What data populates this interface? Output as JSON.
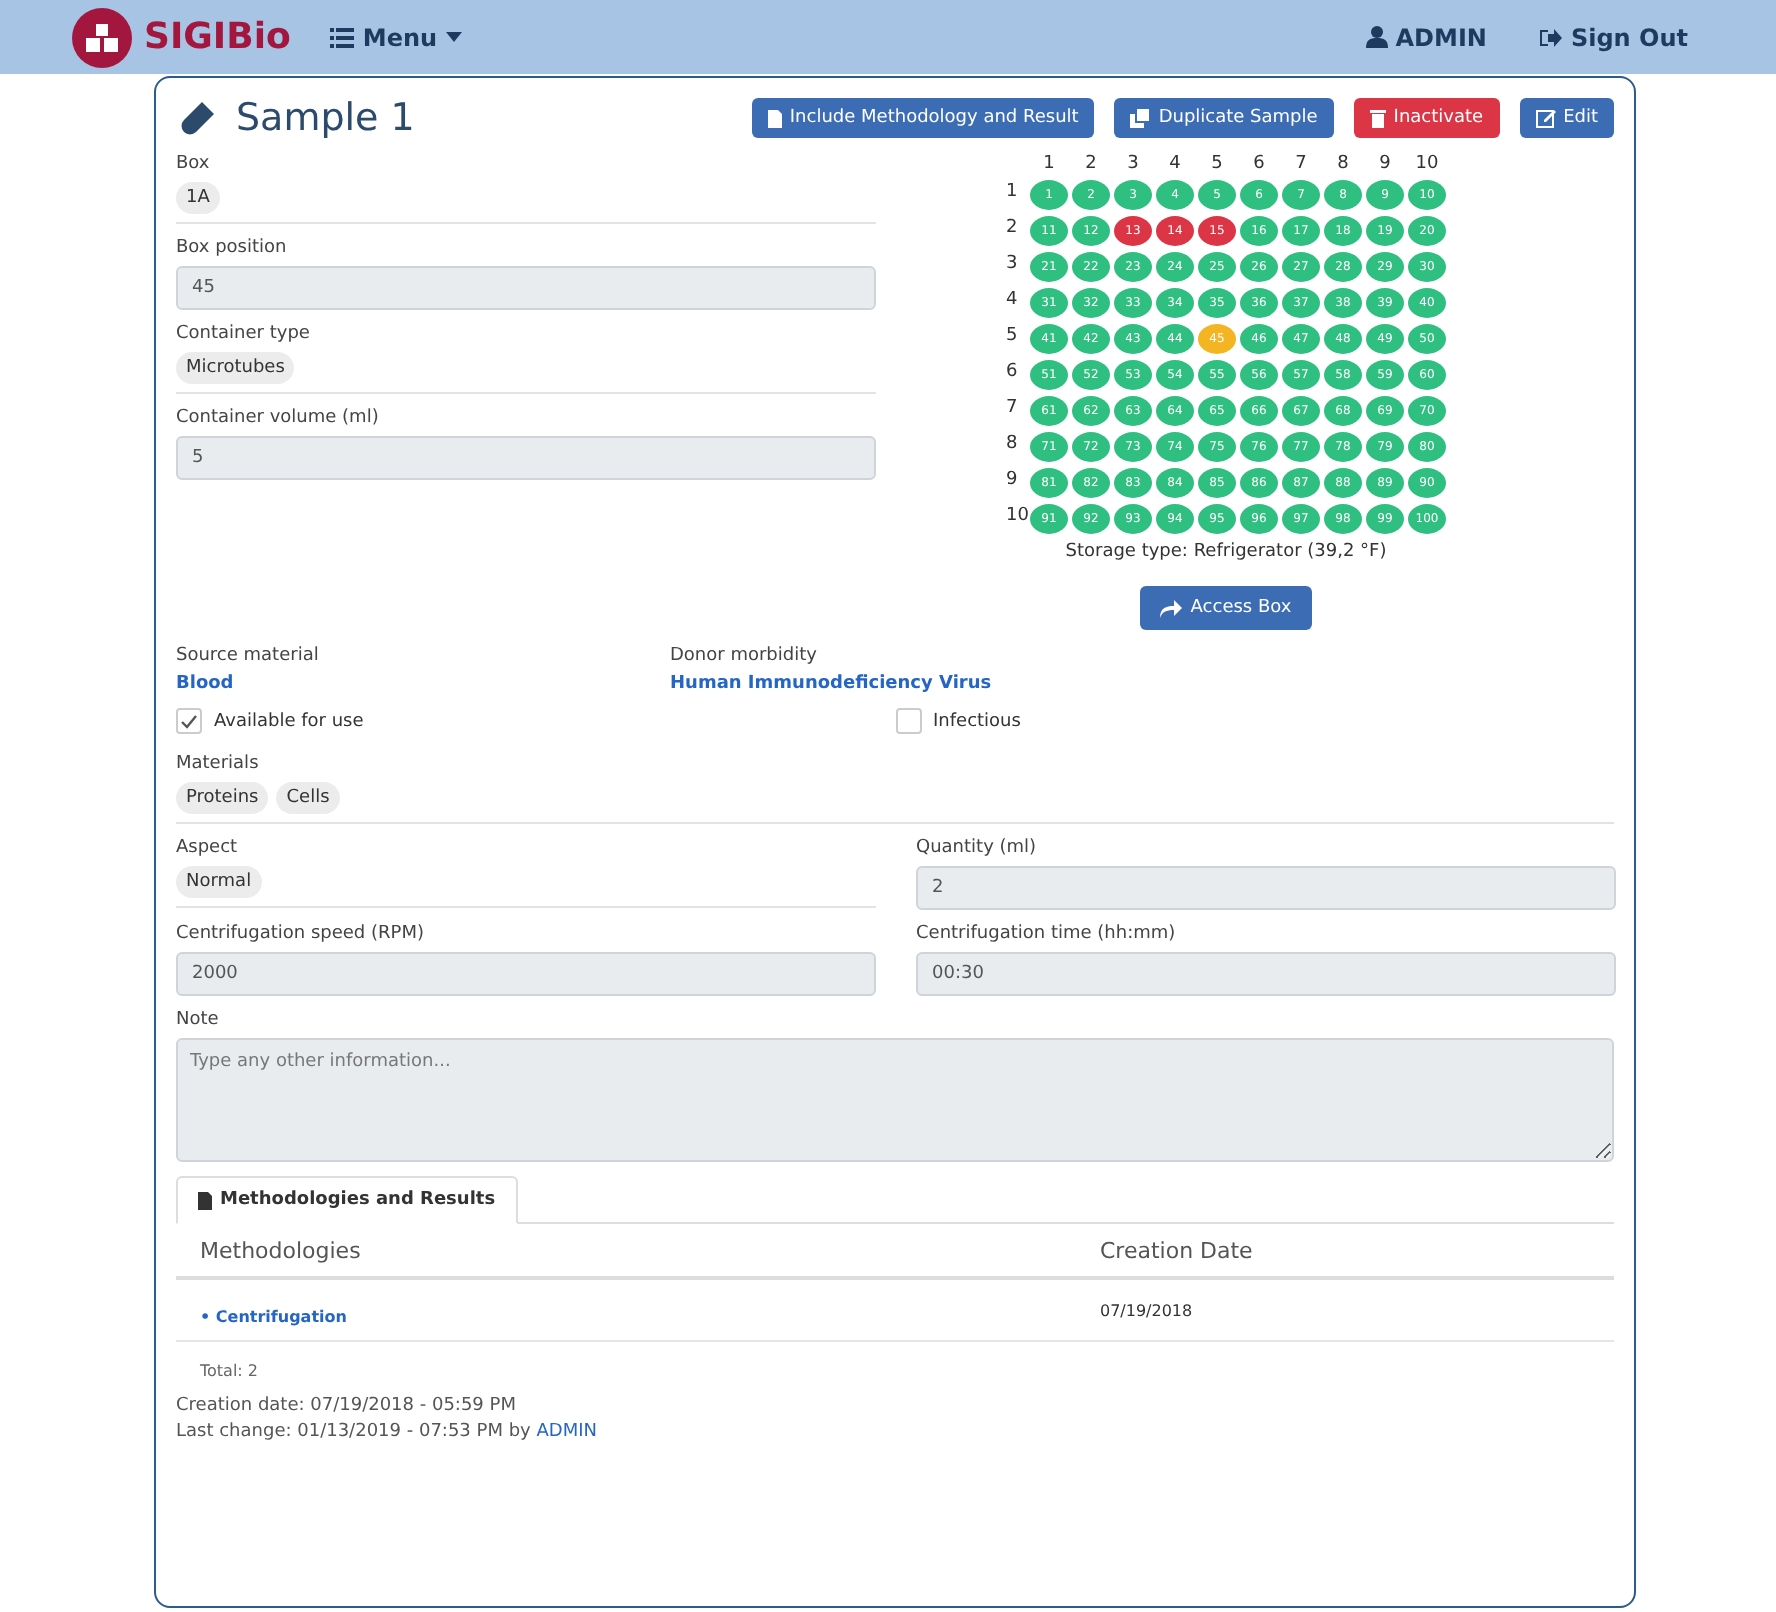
{
  "navbar": {
    "brand": "SIGIBio",
    "menu": "Menu",
    "user": "ADMIN",
    "sign_out": "Sign Out"
  },
  "page": {
    "title": "Sample 1",
    "buttons": [
      {
        "label": "Include Methodology and Result",
        "kind": "include"
      },
      {
        "label": "Duplicate Sample",
        "kind": "duplicate"
      },
      {
        "label": "Inactivate",
        "kind": "inactivate"
      },
      {
        "label": "Edit",
        "kind": "edit"
      }
    ]
  },
  "fields": [
    {
      "label": "Box",
      "value": "1A",
      "kind": "pill"
    },
    {
      "label": "Box position",
      "value": "45",
      "kind": "input"
    },
    {
      "label": "Container type",
      "value": "Microtubes",
      "kind": "pill"
    },
    {
      "label": "Container volume (ml)",
      "value": "5",
      "kind": "input"
    }
  ],
  "box_grid": {
    "columns": [
      "1",
      "2",
      "3",
      "4",
      "5",
      "6",
      "7",
      "8",
      "9",
      "10"
    ],
    "rows": [
      {
        "label": "1",
        "cells": [
          {
            "label": "1",
            "kind": "free"
          },
          {
            "label": "2",
            "kind": "free"
          },
          {
            "label": "3",
            "kind": "free"
          },
          {
            "label": "4",
            "kind": "free"
          },
          {
            "label": "5",
            "kind": "free"
          },
          {
            "label": "6",
            "kind": "free"
          },
          {
            "label": "7",
            "kind": "free"
          },
          {
            "label": "8",
            "kind": "free"
          },
          {
            "label": "9",
            "kind": "free"
          },
          {
            "label": "10",
            "kind": "free"
          }
        ]
      },
      {
        "label": "2",
        "cells": [
          {
            "label": "11",
            "kind": "free"
          },
          {
            "label": "12",
            "kind": "free"
          },
          {
            "label": "13",
            "kind": "occupied"
          },
          {
            "label": "14",
            "kind": "occupied"
          },
          {
            "label": "15",
            "kind": "occupied"
          },
          {
            "label": "16",
            "kind": "free"
          },
          {
            "label": "17",
            "kind": "free"
          },
          {
            "label": "18",
            "kind": "free"
          },
          {
            "label": "19",
            "kind": "free"
          },
          {
            "label": "20",
            "kind": "free"
          }
        ]
      },
      {
        "label": "3",
        "cells": [
          {
            "label": "21",
            "kind": "free"
          },
          {
            "label": "22",
            "kind": "free"
          },
          {
            "label": "23",
            "kind": "free"
          },
          {
            "label": "24",
            "kind": "free"
          },
          {
            "label": "25",
            "kind": "free"
          },
          {
            "label": "26",
            "kind": "free"
          },
          {
            "label": "27",
            "kind": "free"
          },
          {
            "label": "28",
            "kind": "free"
          },
          {
            "label": "29",
            "kind": "free"
          },
          {
            "label": "30",
            "kind": "free"
          }
        ]
      },
      {
        "label": "4",
        "cells": [
          {
            "label": "31",
            "kind": "free"
          },
          {
            "label": "32",
            "kind": "free"
          },
          {
            "label": "33",
            "kind": "free"
          },
          {
            "label": "34",
            "kind": "free"
          },
          {
            "label": "35",
            "kind": "free"
          },
          {
            "label": "36",
            "kind": "free"
          },
          {
            "label": "37",
            "kind": "free"
          },
          {
            "label": "38",
            "kind": "free"
          },
          {
            "label": "39",
            "kind": "free"
          },
          {
            "label": "40",
            "kind": "free"
          }
        ]
      },
      {
        "label": "5",
        "cells": [
          {
            "label": "41",
            "kind": "free"
          },
          {
            "label": "42",
            "kind": "free"
          },
          {
            "label": "43",
            "kind": "free"
          },
          {
            "label": "44",
            "kind": "free"
          },
          {
            "label": "45",
            "kind": "current"
          },
          {
            "label": "46",
            "kind": "free"
          },
          {
            "label": "47",
            "kind": "free"
          },
          {
            "label": "48",
            "kind": "free"
          },
          {
            "label": "49",
            "kind": "free"
          },
          {
            "label": "50",
            "kind": "free"
          }
        ]
      },
      {
        "label": "6",
        "cells": [
          {
            "label": "51",
            "kind": "free"
          },
          {
            "label": "52",
            "kind": "free"
          },
          {
            "label": "53",
            "kind": "free"
          },
          {
            "label": "54",
            "kind": "free"
          },
          {
            "label": "55",
            "kind": "free"
          },
          {
            "label": "56",
            "kind": "free"
          },
          {
            "label": "57",
            "kind": "free"
          },
          {
            "label": "58",
            "kind": "free"
          },
          {
            "label": "59",
            "kind": "free"
          },
          {
            "label": "60",
            "kind": "free"
          }
        ]
      },
      {
        "label": "7",
        "cells": [
          {
            "label": "61",
            "kind": "free"
          },
          {
            "label": "62",
            "kind": "free"
          },
          {
            "label": "63",
            "kind": "free"
          },
          {
            "label": "64",
            "kind": "free"
          },
          {
            "label": "65",
            "kind": "free"
          },
          {
            "label": "66",
            "kind": "free"
          },
          {
            "label": "67",
            "kind": "free"
          },
          {
            "label": "68",
            "kind": "free"
          },
          {
            "label": "69",
            "kind": "free"
          },
          {
            "label": "70",
            "kind": "free"
          }
        ]
      },
      {
        "label": "8",
        "cells": [
          {
            "label": "71",
            "kind": "free"
          },
          {
            "label": "72",
            "kind": "free"
          },
          {
            "label": "73",
            "kind": "free"
          },
          {
            "label": "74",
            "kind": "free"
          },
          {
            "label": "75",
            "kind": "free"
          },
          {
            "label": "76",
            "kind": "free"
          },
          {
            "label": "77",
            "kind": "free"
          },
          {
            "label": "78",
            "kind": "free"
          },
          {
            "label": "79",
            "kind": "free"
          },
          {
            "label": "80",
            "kind": "free"
          }
        ]
      },
      {
        "label": "9",
        "cells": [
          {
            "label": "81",
            "kind": "free"
          },
          {
            "label": "82",
            "kind": "free"
          },
          {
            "label": "83",
            "kind": "free"
          },
          {
            "label": "84",
            "kind": "free"
          },
          {
            "label": "85",
            "kind": "free"
          },
          {
            "label": "86",
            "kind": "free"
          },
          {
            "label": "87",
            "kind": "free"
          },
          {
            "label": "88",
            "kind": "free"
          },
          {
            "label": "89",
            "kind": "free"
          },
          {
            "label": "90",
            "kind": "free"
          }
        ]
      },
      {
        "label": "10",
        "cells": [
          {
            "label": "91",
            "kind": "free"
          },
          {
            "label": "92",
            "kind": "free"
          },
          {
            "label": "93",
            "kind": "free"
          },
          {
            "label": "94",
            "kind": "free"
          },
          {
            "label": "95",
            "kind": "free"
          },
          {
            "label": "96",
            "kind": "free"
          },
          {
            "label": "97",
            "kind": "free"
          },
          {
            "label": "98",
            "kind": "free"
          },
          {
            "label": "99",
            "kind": "free"
          },
          {
            "label": "100",
            "kind": "free"
          }
        ]
      }
    ],
    "storage": "Storage type: Refrigerator (39,2 °F)",
    "access_button": "Access Box"
  },
  "source": {
    "label": "Source material",
    "value": "Blood"
  },
  "morbidity": {
    "label": "Donor morbidity",
    "value": "Human Immunodeficiency Virus"
  },
  "checks": [
    {
      "label": "Available for use",
      "checked": true
    },
    {
      "label": "Infectious",
      "checked": false
    }
  ],
  "materials": {
    "label": "Materials",
    "items": [
      "Proteins",
      "Cells"
    ]
  },
  "pairs": [
    {
      "label": "Aspect",
      "value": "Normal",
      "kind": "pill"
    },
    {
      "label": "Quantity (ml)",
      "value": "2",
      "kind": "input"
    },
    {
      "label": "Centrifugation speed (RPM)",
      "value": "2000",
      "kind": "input"
    },
    {
      "label": "Centrifugation time (hh:mm)",
      "value": "00:30",
      "kind": "input"
    }
  ],
  "note": {
    "label": "Note",
    "placeholder": "Type any other information..."
  },
  "tab": {
    "label": "Methodologies and Results",
    "selected": true
  },
  "table": {
    "columns": [
      "Methodologies",
      "Creation Date"
    ],
    "rows": [
      {
        "name": "• Centrifugation",
        "date": "07/19/2018"
      }
    ],
    "total": "Total: 2"
  },
  "footer": {
    "created": "Creation date: 07/19/2018 - 05:59 PM",
    "changed": "Last change: 01/13/2019 - 07:53 PM by",
    "user": "ADMIN"
  }
}
